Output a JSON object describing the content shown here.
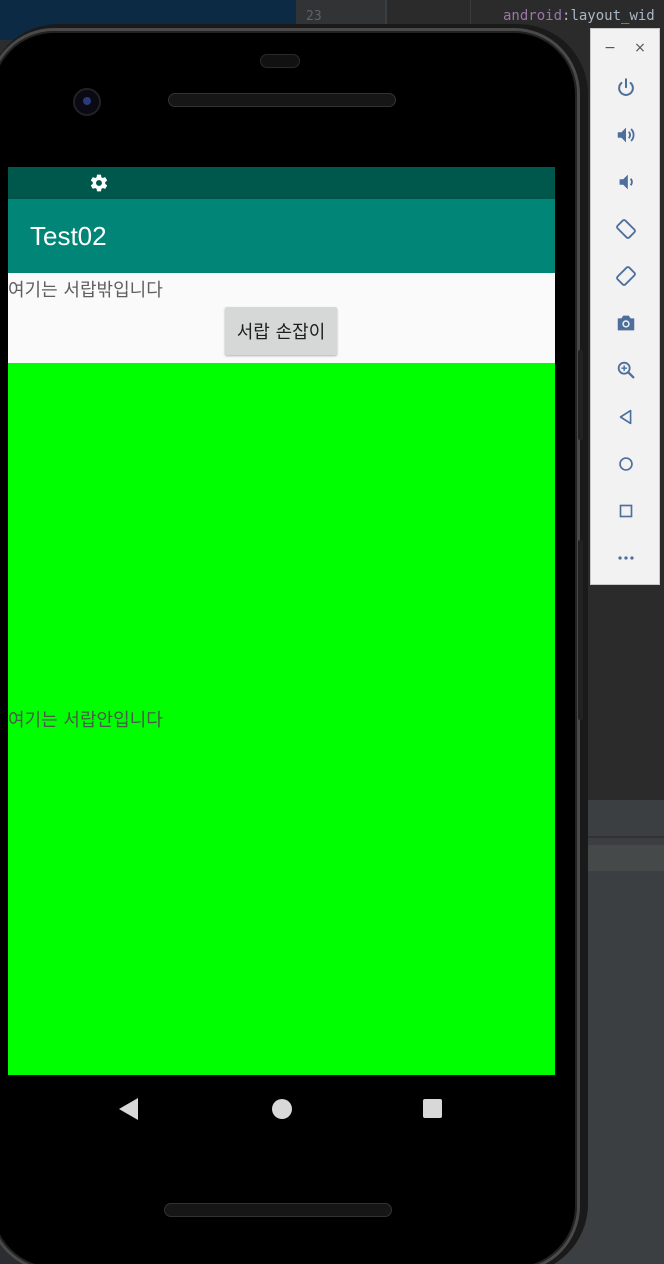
{
  "ide": {
    "gutter_line": "23",
    "code_keyword": "android",
    "code_rest": ":layout_wid"
  },
  "app": {
    "title": "Test02",
    "outside_text": "여기는 서랍밖입니다",
    "handle_button_label": "서랍 손잡이",
    "inside_text": "여기는 서랍안입니다"
  },
  "colors": {
    "status_bar": "#00574b",
    "app_bar": "#008577",
    "drawer_content": "#00ff00"
  },
  "status_bar": {
    "icons": [
      "gear-icon"
    ]
  },
  "navigation_bar": {
    "buttons": [
      "back-icon",
      "home-icon",
      "recents-icon"
    ]
  },
  "emulator_toolbar": {
    "window_buttons": {
      "minimize": "−",
      "close": "×"
    },
    "buttons": [
      "power-icon",
      "volume-up-icon",
      "volume-down-icon",
      "rotate-left-icon",
      "rotate-right-icon",
      "camera-icon",
      "zoom-icon",
      "back-icon",
      "home-icon",
      "overview-icon",
      "more-icon"
    ]
  }
}
